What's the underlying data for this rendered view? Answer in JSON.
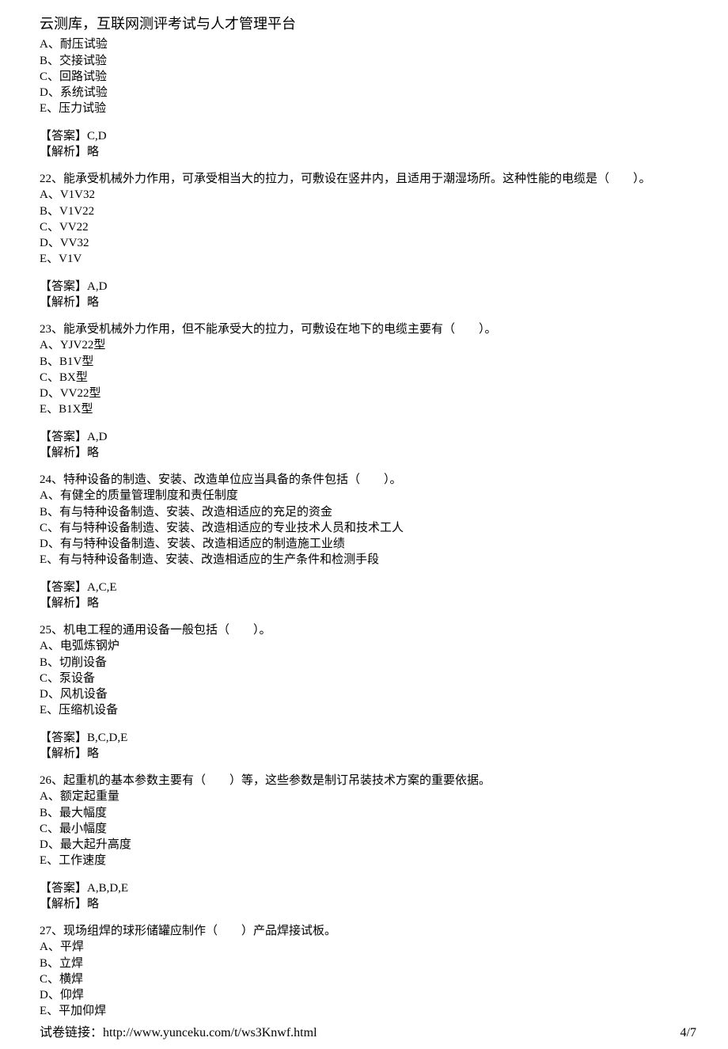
{
  "header": {
    "title": "云测库，互联网测评考试与人才管理平台"
  },
  "q21_tail": {
    "options": [
      "A、耐压试验",
      "B、交接试验",
      "C、回路试验",
      "D、系统试验",
      "E、压力试验"
    ],
    "answer": "【答案】C,D",
    "analysis": "【解析】略"
  },
  "q22": {
    "stem": "22、能承受机械外力作用，可承受相当大的拉力，可敷设在竖井内，且适用于潮湿场所。这种性能的电缆是（　　）。",
    "options": [
      "A、V1V32",
      "B、V1V22",
      "C、VV22",
      "D、VV32",
      "E、V1V"
    ],
    "answer": "【答案】A,D",
    "analysis": "【解析】略"
  },
  "q23": {
    "stem": "23、能承受机械外力作用，但不能承受大的拉力，可敷设在地下的电缆主要有（　　）。",
    "options": [
      "A、YJV22型",
      "B、B1V型",
      "C、BX型",
      "D、VV22型",
      "E、B1X型"
    ],
    "answer": "【答案】A,D",
    "analysis": "【解析】略"
  },
  "q24": {
    "stem": "24、特种设备的制造、安装、改造单位应当具备的条件包括（　　）。",
    "options": [
      "A、有健全的质量管理制度和责任制度",
      "B、有与特种设备制造、安装、改造相适应的充足的资金",
      "C、有与特种设备制造、安装、改造相适应的专业技术人员和技术工人",
      "D、有与特种设备制造、安装、改造相适应的制造施工业绩",
      "E、有与特种设备制造、安装、改造相适应的生产条件和检测手段"
    ],
    "answer": "【答案】A,C,E",
    "analysis": "【解析】略"
  },
  "q25": {
    "stem": "25、机电工程的通用设备一般包括（　　）。",
    "options": [
      "A、电弧炼钢炉",
      "B、切削设备",
      "C、泵设备",
      "D、风机设备",
      "E、压缩机设备"
    ],
    "answer": "【答案】B,C,D,E",
    "analysis": "【解析】略"
  },
  "q26": {
    "stem": "26、起重机的基本参数主要有（　　）等，这些参数是制订吊装技术方案的重要依据。",
    "options": [
      "A、额定起重量",
      "B、最大幅度",
      "C、最小幅度",
      "D、最大起升高度",
      "E、工作速度"
    ],
    "answer": "【答案】A,B,D,E",
    "analysis": "【解析】略"
  },
  "q27": {
    "stem": "27、现场组焊的球形储罐应制作（　　）产品焊接试板。",
    "options": [
      "A、平焊",
      "B、立焊",
      "C、横焊",
      "D、仰焊",
      "E、平加仰焊"
    ]
  },
  "footer": {
    "link_label": "试卷链接：",
    "link_url": "http://www.yunceku.com/t/ws3Knwf.html",
    "page": "4/7"
  }
}
